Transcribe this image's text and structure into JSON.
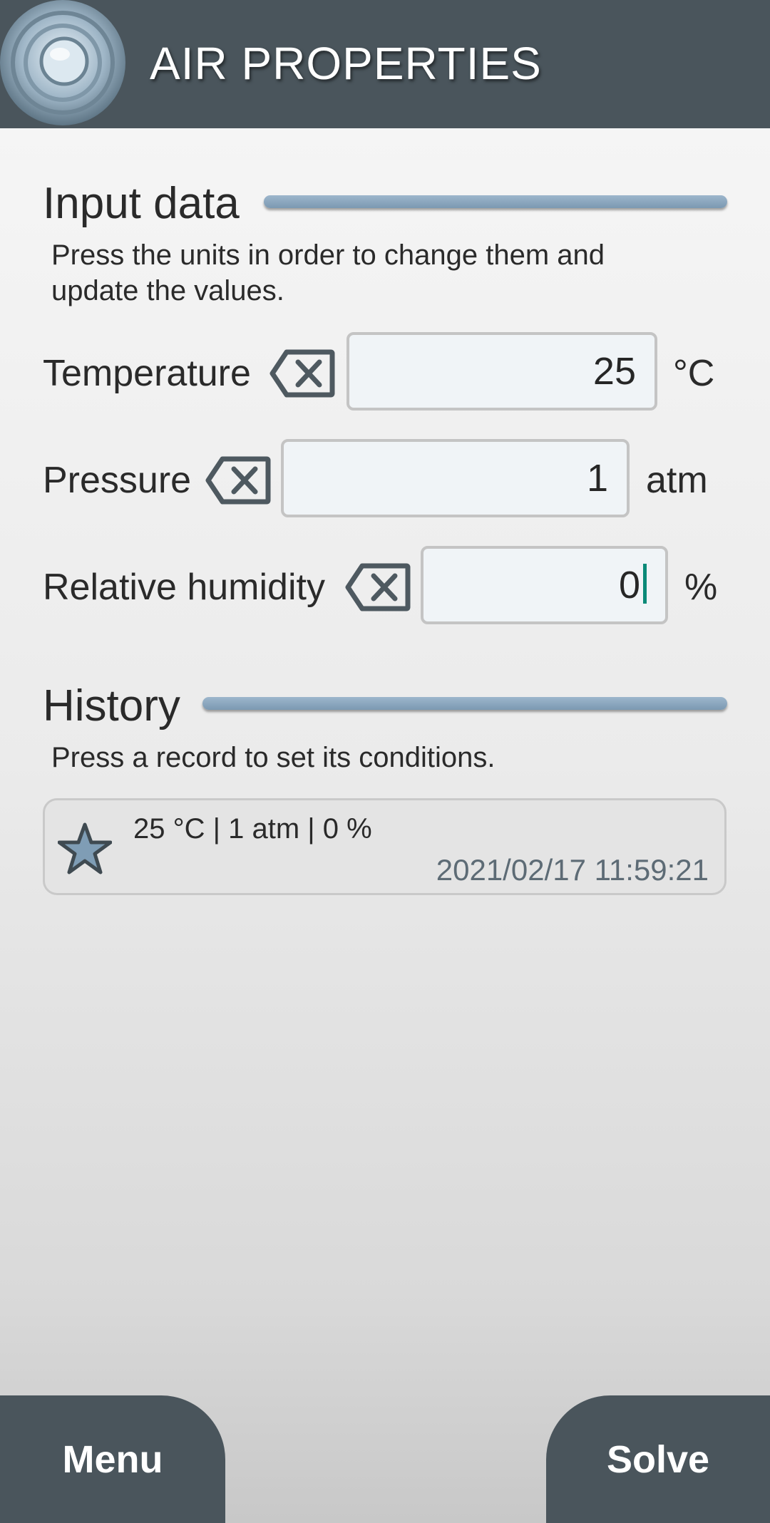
{
  "header": {
    "title": "AIR PROPERTIES",
    "logo_icon": "concentric-circles-logo"
  },
  "input_section": {
    "title": "Input data",
    "description_line1": "Press the units in order to change them and",
    "description_line2": "update the values.",
    "rows": [
      {
        "label": "Temperature",
        "value": "25",
        "unit": "°C",
        "clear_icon": "backspace-icon"
      },
      {
        "label": "Pressure",
        "value": "1",
        "unit": "atm",
        "clear_icon": "backspace-icon"
      },
      {
        "label": "Relative humidity",
        "value": "0",
        "unit": "%",
        "clear_icon": "backspace-icon"
      }
    ]
  },
  "history_section": {
    "title": "History",
    "description": "Press a record to set its conditions.",
    "records": [
      {
        "conditions": "25 °C | 1 atm | 0 %",
        "timestamp": "2021/02/17 11:59:21",
        "icon": "star-icon"
      }
    ]
  },
  "footer": {
    "menu_label": "Menu",
    "solve_label": "Solve"
  },
  "colors": {
    "bar": "#4a555c",
    "accent_line": "#8aa7bf",
    "field_bg": "#f0f4f7",
    "caret": "#0a8a78"
  }
}
